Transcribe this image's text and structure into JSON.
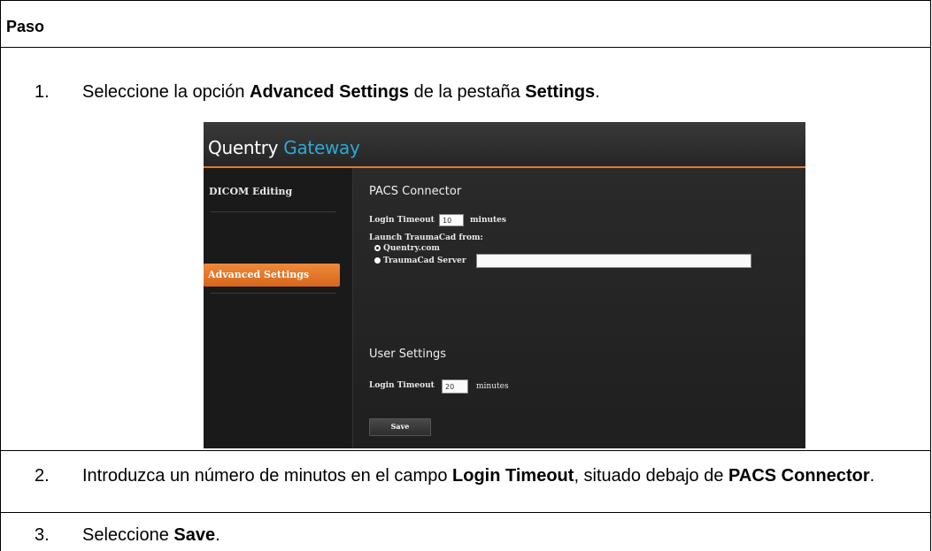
{
  "header": {
    "label": "Paso"
  },
  "steps": [
    {
      "number": "1.",
      "before": "Seleccione la opción ",
      "bold1": "Advanced Settings",
      "middle": " de la pestaña ",
      "bold2": "Settings",
      "after": "."
    },
    {
      "number": "2.",
      "before": "Introduzca un número de minutos en el campo ",
      "bold1": "Login Timeout",
      "middle": ", situado debajo de ",
      "bold2": "PACS Connector",
      "after": "."
    },
    {
      "number": "3.",
      "before": "Seleccione ",
      "bold1": "Save",
      "after": "."
    }
  ],
  "app": {
    "title_main": "Quentry ",
    "title_accent": "Gateway",
    "accent_color": "#2aa9d6",
    "highlight_color": "#e07a2a",
    "sidebar": {
      "items": [
        {
          "label": "DICOM Editing",
          "active": false
        },
        {
          "label": "Advanced Settings",
          "active": true
        }
      ]
    },
    "pacs": {
      "title": "PACS Connector",
      "login_timeout_label": "Login Timeout",
      "login_timeout_value": "10",
      "minutes_label": "minutes",
      "launch_label": "Launch TraumaCad from:",
      "option_quentry": "Quentry.com",
      "option_server": "TraumaCad Server",
      "server_value": ""
    },
    "user": {
      "title": "User Settings",
      "login_timeout_label": "Login Timeout",
      "login_timeout_value": "20",
      "minutes_label": "minutes"
    },
    "save_label": "Save"
  }
}
